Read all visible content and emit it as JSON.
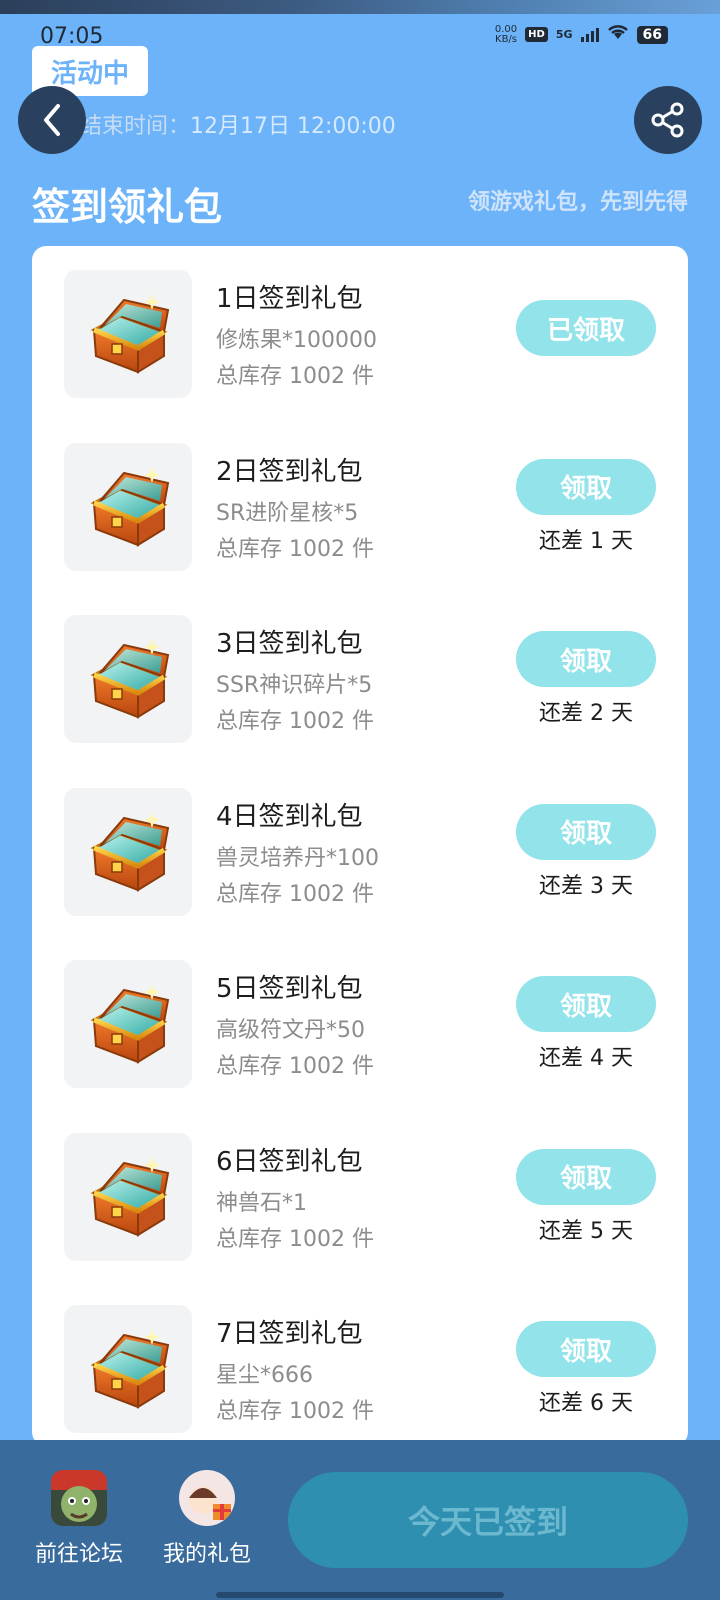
{
  "status": {
    "time": "07:05",
    "net_speed": "0.00",
    "net_unit": "KB/s",
    "hd": "HD",
    "signal": "5G",
    "battery": "66"
  },
  "header": {
    "badge": "活动中",
    "end_label": "活动结束时间：",
    "end_time": "12月17日 12:00:00"
  },
  "section": {
    "title": "签到领礼包",
    "subtitle": "领游戏礼包，先到先得"
  },
  "items": [
    {
      "title": "1日签到礼包",
      "desc": "修炼果*100000",
      "stock": "总库存 1002 件",
      "button": "已领取",
      "remain": ""
    },
    {
      "title": "2日签到礼包",
      "desc": "SR进阶星核*5",
      "stock": "总库存 1002 件",
      "button": "领取",
      "remain": "还差 1 天"
    },
    {
      "title": "3日签到礼包",
      "desc": "SSR神识碎片*5",
      "stock": "总库存 1002 件",
      "button": "领取",
      "remain": "还差 2 天"
    },
    {
      "title": "4日签到礼包",
      "desc": "兽灵培养丹*100",
      "stock": "总库存 1002 件",
      "button": "领取",
      "remain": "还差 3 天"
    },
    {
      "title": "5日签到礼包",
      "desc": "高级符文丹*50",
      "stock": "总库存 1002 件",
      "button": "领取",
      "remain": "还差 4 天"
    },
    {
      "title": "6日签到礼包",
      "desc": "神兽石*1",
      "stock": "总库存 1002 件",
      "button": "领取",
      "remain": "还差 5 天"
    },
    {
      "title": "7日签到礼包",
      "desc": "星尘*666",
      "stock": "总库存 1002 件",
      "button": "领取",
      "remain": "还差 6 天"
    }
  ],
  "bottom": {
    "forum": "前往论坛",
    "my_gifts": "我的礼包",
    "signed": "今天已签到"
  },
  "colors": {
    "background": "#6cb3f9",
    "button": "#92e3ea",
    "bottom_bar": "#3a6b9d",
    "icon_circle": "#29415e"
  }
}
